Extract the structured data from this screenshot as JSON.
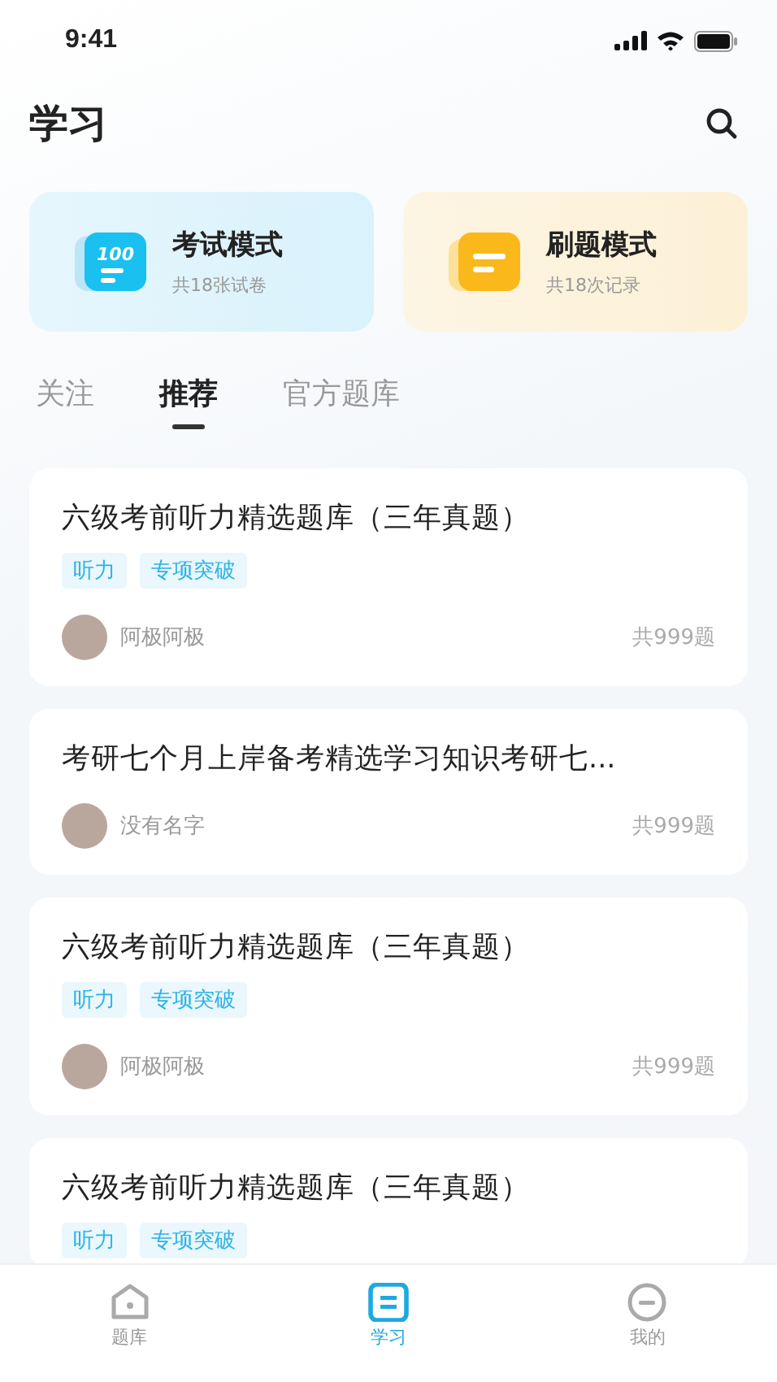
{
  "status_bar": {
    "time": "9:41"
  },
  "header": {
    "title": "学习"
  },
  "modes": [
    {
      "kind": "exam",
      "title": "考试模式",
      "subtitle": "共18张试卷",
      "icon_text": "100"
    },
    {
      "kind": "practice",
      "title": "刷题模式",
      "subtitle": "共18次记录"
    }
  ],
  "tabs": [
    {
      "label": "关注",
      "selected": false
    },
    {
      "label": "推荐",
      "selected": true
    },
    {
      "label": "官方题库",
      "selected": false
    }
  ],
  "cards": [
    {
      "title": "六级考前听力精选题库（三年真题）",
      "tags": [
        "听力",
        "专项突破"
      ],
      "author": "阿极阿极",
      "count": "共999题"
    },
    {
      "title": "考研七个月上岸备考精选学习知识考研七...",
      "author": "没有名字",
      "count": "共999题"
    },
    {
      "title": "六级考前听力精选题库（三年真题）",
      "tags": [
        "听力",
        "专项突破"
      ],
      "author": "阿极阿极",
      "count": "共999题"
    },
    {
      "title": "六级考前听力精选题库（三年真题）",
      "tags": [
        "听力",
        "专项突破"
      ]
    }
  ],
  "nav": [
    {
      "kind": "home",
      "label": "题库",
      "selected": false
    },
    {
      "kind": "study",
      "label": "学习",
      "selected": true
    },
    {
      "kind": "me",
      "label": "我的",
      "selected": false
    }
  ]
}
